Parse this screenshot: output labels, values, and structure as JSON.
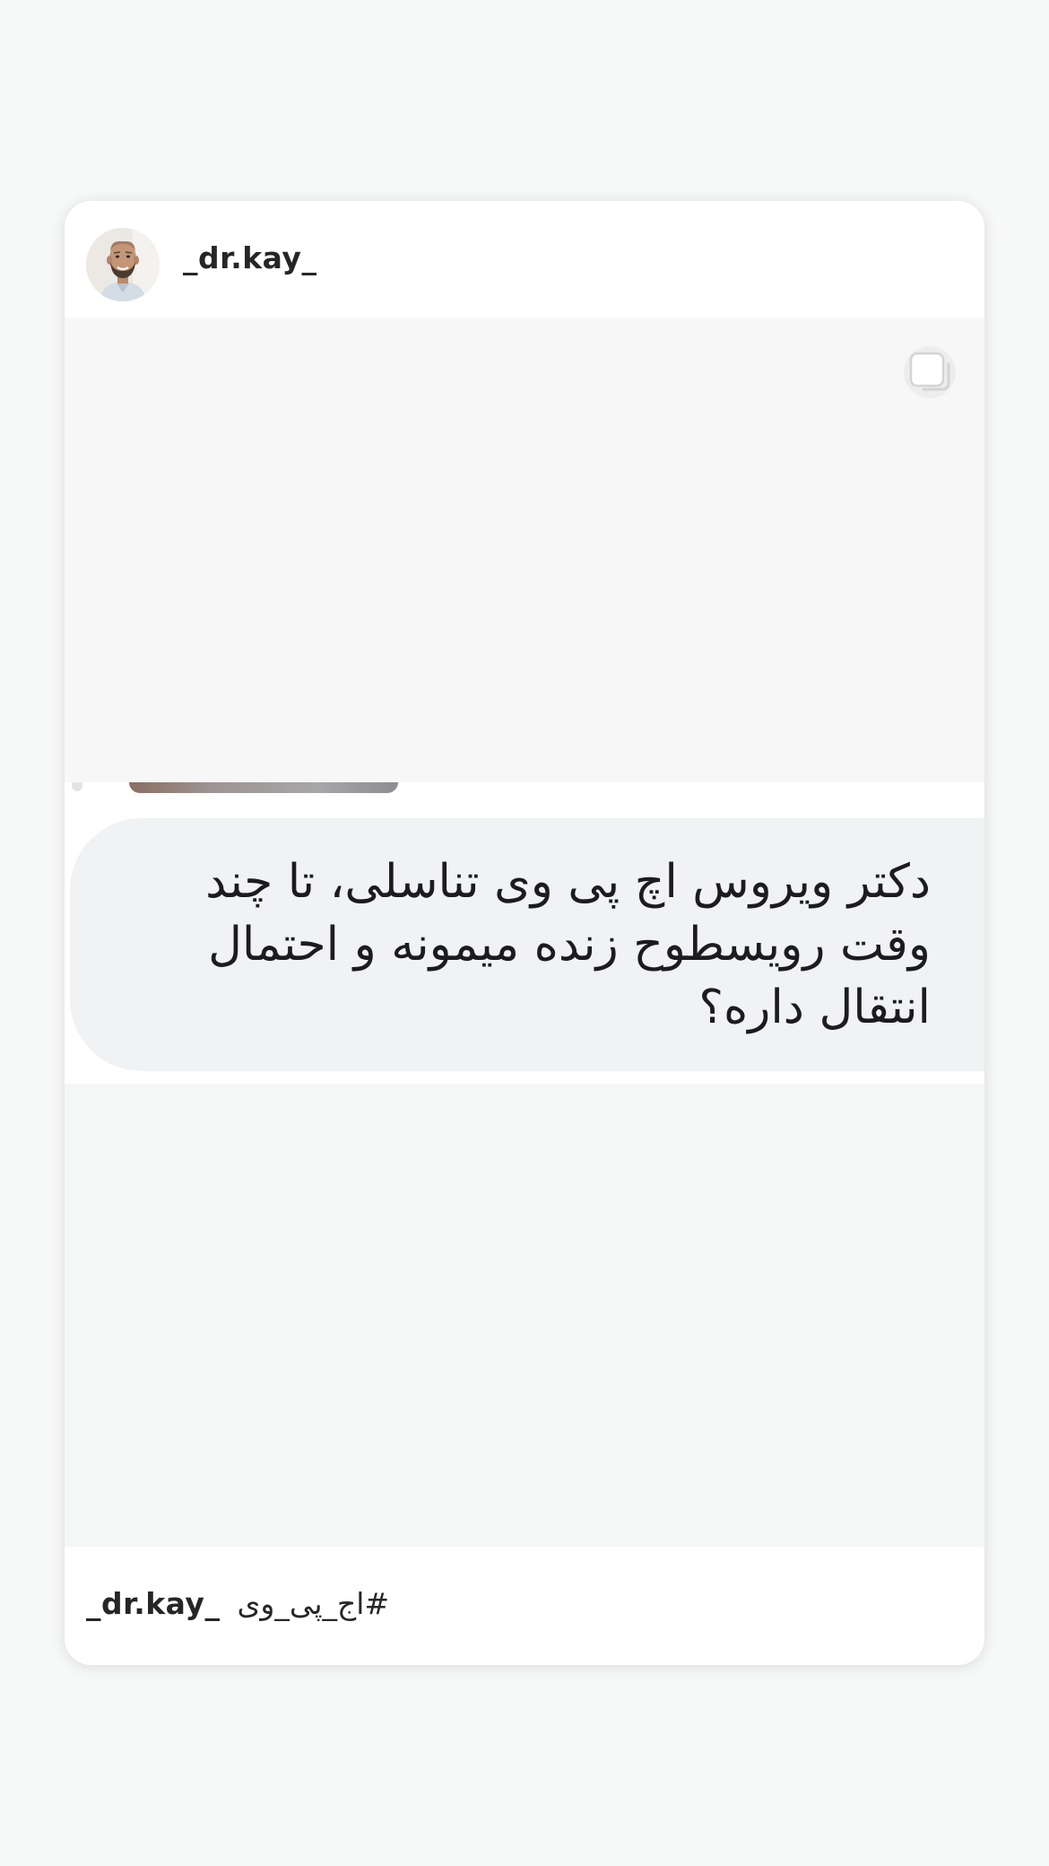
{
  "post": {
    "username": "_dr.kay_",
    "question": "دکتر ویروس اچ پی وی تناسلی، تا چند وقت رویسطوح زنده میمونه و احتمال انتقال داره؟",
    "caption": {
      "username": "_dr.kay_",
      "hashtag": "#اج_پی_وی"
    },
    "icons": {
      "avatar": "profile-photo",
      "carousel": "multiple-images-icon"
    }
  },
  "colors": {
    "page_background": "#f7f8f8",
    "card_background": "#ffffff",
    "bubble_background": "#f1f2f4",
    "text_primary": "#262626"
  }
}
